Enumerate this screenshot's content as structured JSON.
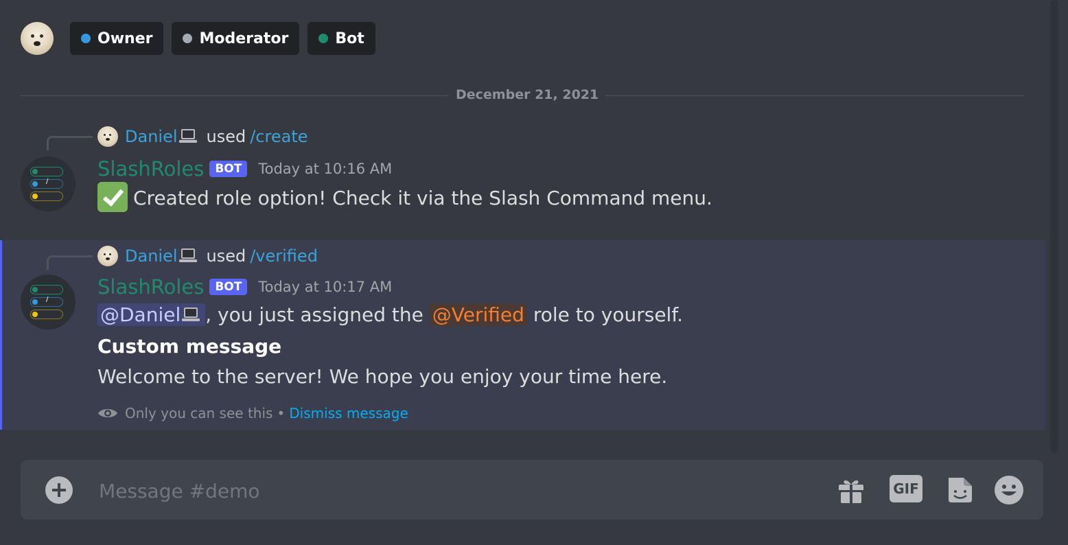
{
  "roles": [
    {
      "label": "Owner",
      "color": "#3498db"
    },
    {
      "label": "Moderator",
      "color": "#a3aab2"
    },
    {
      "label": "Bot",
      "color": "#1f8b6c"
    }
  ],
  "divider": {
    "date": "December 21, 2021"
  },
  "messages": [
    {
      "reply": {
        "user": "Daniel",
        "verb": "used",
        "command": "/create"
      },
      "author": "SlashRoles",
      "tag": "BOT",
      "timestamp": "Today at 10:16 AM",
      "text": "Created role option! Check it via the Slash Command menu."
    },
    {
      "reply": {
        "user": "Daniel",
        "verb": "used",
        "command": "/verified"
      },
      "author": "SlashRoles",
      "tag": "BOT",
      "timestamp": "Today at 10:17 AM",
      "mention_user": "@Daniel",
      "text_mid": ", you just assigned the ",
      "mention_role": "@Verified",
      "text_end": " role to yourself.",
      "bold_line": "Custom message",
      "body": "Welcome to the server! We hope you enjoy your time here.",
      "note": "Only you can see this",
      "separator": "•",
      "dismiss": "Dismiss message"
    }
  ],
  "composer": {
    "placeholder": "Message #demo",
    "gif_label": "GIF"
  },
  "colors": {
    "accent": "#5865f2",
    "bot_name": "#1f8b6c",
    "link": "#00aff4",
    "role_mention": "#f77e2e"
  }
}
